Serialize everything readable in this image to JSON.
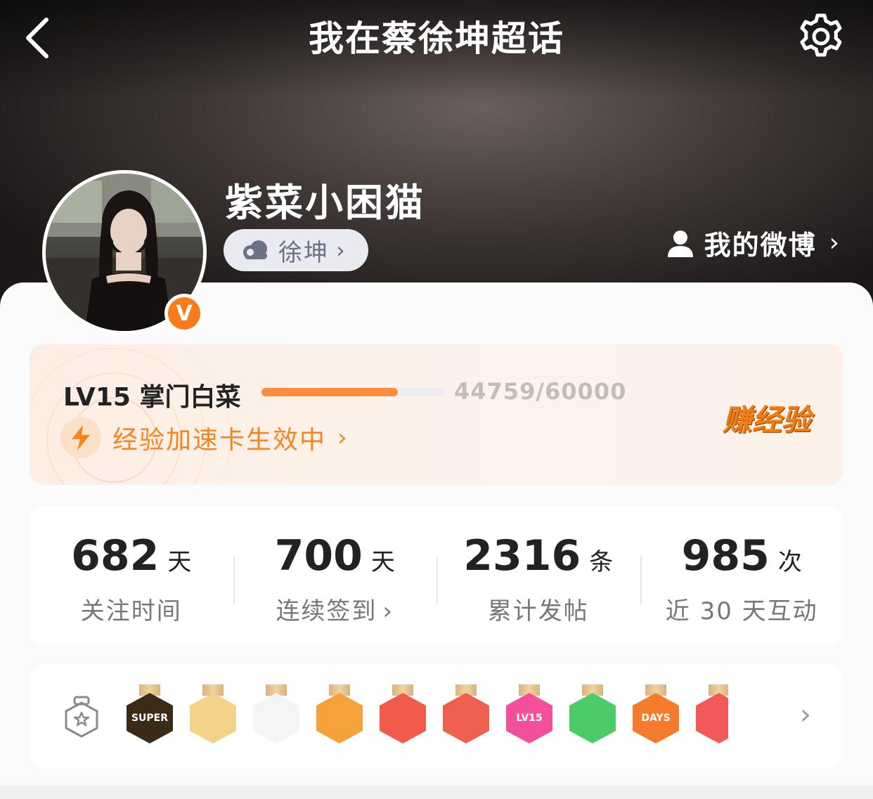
{
  "header": {
    "title": "我在蔡徐坤超话",
    "back_icon": "chevron-left-icon",
    "settings_icon": "gear-icon"
  },
  "profile": {
    "username": "紫菜小困猫",
    "verified_badge": "V",
    "fan_tag": "徐坤",
    "fan_tag_icon": "cloud-icon",
    "my_weibo_label": "我的微博",
    "my_weibo_icon": "person-icon"
  },
  "level": {
    "name": "LV15 掌门白菜",
    "progress_text": "44759/60000",
    "progress_fraction": 0.746,
    "boost_label": "经验加速卡生效中",
    "boost_icon": "lightning-icon",
    "earn_label": "赚经验",
    "accent": "#f5861f"
  },
  "stats": [
    {
      "value": "682",
      "unit": "天",
      "label": "关注时间",
      "link": false
    },
    {
      "value": "700",
      "unit": "天",
      "label": "连续签到",
      "link": true
    },
    {
      "value": "2316",
      "unit": "条",
      "label": "累计发帖",
      "link": false
    },
    {
      "value": "985",
      "unit": "次",
      "label": "近 30 天互动",
      "link": false
    }
  ],
  "medals": {
    "section_icon": "medal-star-icon",
    "items": [
      {
        "name": "super-medal",
        "label": "SUPER",
        "color": "#3a2a16"
      },
      {
        "name": "anime-avatar-medal",
        "label": "",
        "color": "#f3d28a"
      },
      {
        "name": "cowboy-hat-medal",
        "label": "",
        "color": "#ffffff"
      },
      {
        "name": "crown-medal",
        "label": "",
        "color": "#f6a23a"
      },
      {
        "name": "rabbit-medal",
        "label": "",
        "color": "#f25a4a"
      },
      {
        "name": "cat-medal",
        "label": "",
        "color": "#f0604e"
      },
      {
        "name": "lv15-medal",
        "label": "LV15",
        "color": "#f2509a"
      },
      {
        "name": "hand-medal",
        "label": "",
        "color": "#4ccb6a"
      },
      {
        "name": "100-days-medal",
        "label": "DAYS",
        "color": "#f47b2c"
      },
      {
        "name": "trophy-medal",
        "label": "",
        "color": "#f25a5a"
      }
    ],
    "more_icon": "chevron-right-icon"
  }
}
